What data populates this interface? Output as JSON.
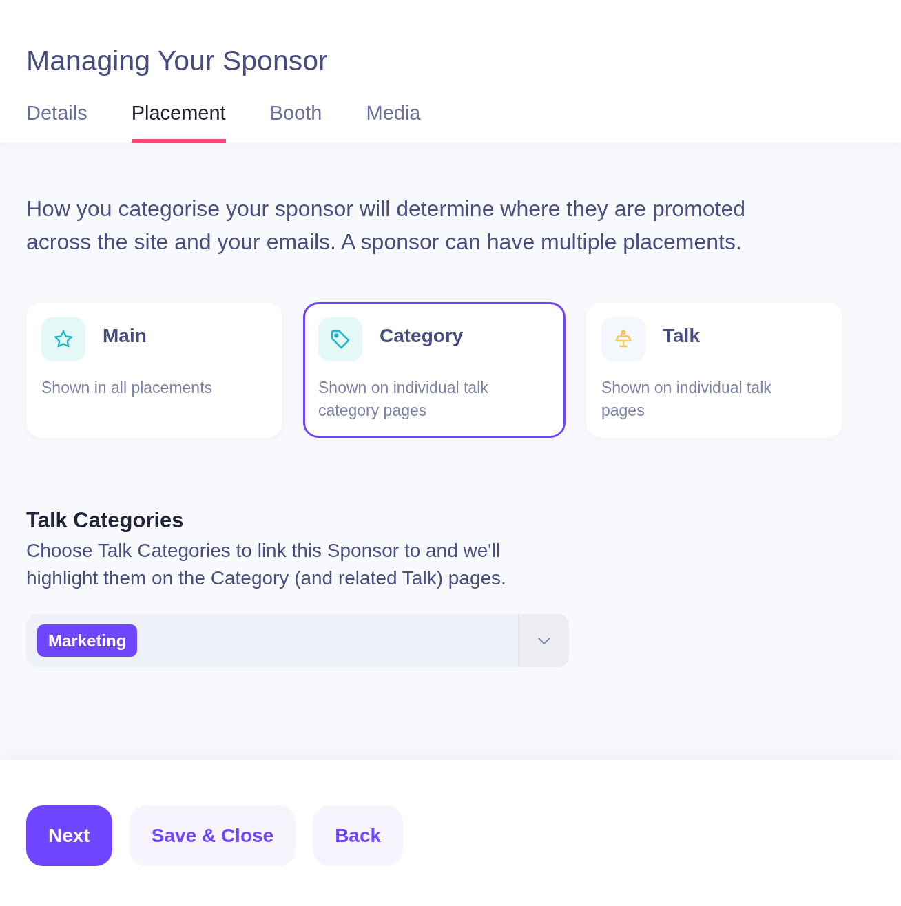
{
  "header": {
    "title": "Managing Your Sponsor"
  },
  "tabs": [
    {
      "label": "Details",
      "selected": false
    },
    {
      "label": "Placement",
      "selected": true
    },
    {
      "label": "Booth",
      "selected": false
    },
    {
      "label": "Media",
      "selected": false
    }
  ],
  "intro": "How you categorise your sponsor will determine where they are promoted across the site and your emails. A sponsor can have multiple placements.",
  "placements": [
    {
      "kind": "star",
      "title": "Main",
      "description": "Shown in all placements",
      "selected": false
    },
    {
      "kind": "tag",
      "title": "Category",
      "description": "Shown on individual talk category pages",
      "selected": true
    },
    {
      "kind": "lectern",
      "title": "Talk",
      "description": "Shown on individual talk pages",
      "selected": false
    }
  ],
  "talk_categories": {
    "heading": "Talk Categories",
    "description": "Choose Talk Categories to link this Sponsor to and we'll highlight them on the Category (and related Talk) pages.",
    "selected_tags": [
      "Marketing"
    ]
  },
  "buttons": [
    {
      "label": "Next",
      "kind": "primary"
    },
    {
      "label": "Save & Close",
      "kind": "secondary"
    },
    {
      "label": "Back",
      "kind": "secondary"
    }
  ]
}
